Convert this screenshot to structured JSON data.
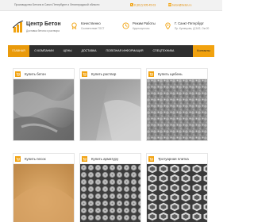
{
  "topbar": {
    "promo": "Производство Бетона в Санкт-Петербурге и Ленинградской области",
    "phone": "8 (812) 905-45-03",
    "email": "beton@beton.ru"
  },
  "brand": {
    "title": "Центр Бетон",
    "subtitle": "Доставка бетона и раствора"
  },
  "features": [
    {
      "title": "Качественно",
      "sub": "Соответствие ГОСТ",
      "icon": "award-icon"
    },
    {
      "title": "Режим Работы",
      "sub": "Круглосуточно",
      "icon": "clock-icon"
    },
    {
      "title": "Г. Санкт-Петербург",
      "sub": "Пр. Кузнецовъ, Д.34/2, Ом 20",
      "icon": "location-icon"
    }
  ],
  "nav": {
    "items": [
      "ГЛАВНАЯ",
      "О КОМПАНИИ",
      "ЦЕНЫ",
      "ДОСТАВКА",
      "ПОЛЕЗНАЯ ИНФОРМАЦИЯ",
      "СПЕЦТЕХНИКА"
    ],
    "cta": "Контакты"
  },
  "products": [
    {
      "label": "Купить бетон",
      "icon": "cart-icon"
    },
    {
      "label": "Купить раствор",
      "icon": "cart-icon"
    },
    {
      "label": "Купить щебень",
      "icon": "cart-icon"
    },
    {
      "label": "Купить песок",
      "icon": "cart-icon"
    },
    {
      "label": "Купить арматуру",
      "icon": "cart-icon"
    },
    {
      "label": "Тротуарная плитка",
      "icon": "cart-icon"
    }
  ],
  "colors": {
    "accent": "#f1a20f",
    "nav_bg": "#2f2f2f",
    "brand_dark": "#2b2b2b"
  }
}
